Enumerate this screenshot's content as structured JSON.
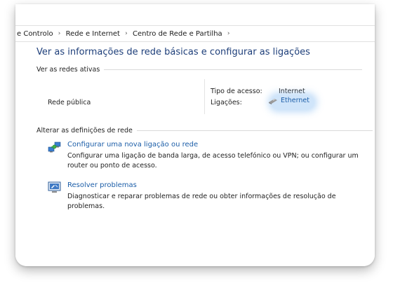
{
  "breadcrumb": {
    "items": [
      "e Controlo",
      "Rede e Internet",
      "Centro de Rede e Partilha"
    ],
    "separator": "›"
  },
  "page_title": "Ver as informações de rede básicas e configurar as ligações",
  "active_networks": {
    "heading": "Ver as redes ativas",
    "network_name": "Rede pública",
    "access_type_label": "Tipo de acesso:",
    "access_type_value": "Internet",
    "connections_label": "Ligações:",
    "connection_value": "Ethernet"
  },
  "change_settings": {
    "heading": "Alterar as definições de rede",
    "tasks": [
      {
        "link": "Configurar uma nova ligação ou rede",
        "description": "Configurar uma ligação de banda larga, de acesso telefónico ou VPN; ou configurar um router ou ponto de acesso.",
        "icon": "network-setup-icon"
      },
      {
        "link": "Resolver problemas",
        "description": "Diagnosticar e reparar problemas de rede ou obter informações de resolução de problemas.",
        "icon": "troubleshoot-icon"
      }
    ]
  },
  "colors": {
    "title": "#1e3f7a",
    "link": "#1c5ea8",
    "highlight": "#78b4f0"
  }
}
